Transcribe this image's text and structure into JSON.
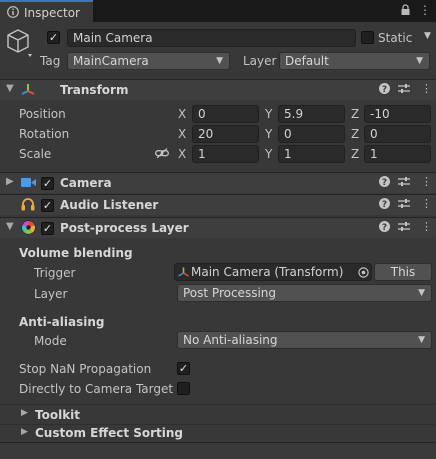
{
  "tab": {
    "title": "Inspector",
    "lock_icon": "lock-icon",
    "menu_icon": "kebab-menu-icon"
  },
  "header": {
    "object_icon": "cube-icon",
    "active": true,
    "name": "Main Camera",
    "static_label": "Static",
    "static_checked": false,
    "tag_label": "Tag",
    "tag_value": "MainCamera",
    "layer_label": "Layer",
    "layer_value": "Default"
  },
  "transform": {
    "title": "Transform",
    "position": {
      "label": "Position",
      "x": "0",
      "y": "5.9",
      "z": "-10"
    },
    "rotation": {
      "label": "Rotation",
      "x": "20",
      "y": "0",
      "z": "0"
    },
    "scale": {
      "label": "Scale",
      "x": "1",
      "y": "1",
      "z": "1"
    },
    "axis_labels": {
      "x": "X",
      "y": "Y",
      "z": "Z"
    }
  },
  "camera": {
    "title": "Camera",
    "enabled": true
  },
  "audio_listener": {
    "title": "Audio Listener",
    "enabled": true
  },
  "postprocess_layer": {
    "title": "Post-process Layer",
    "enabled": true,
    "volume_blending": {
      "section_title": "Volume blending",
      "trigger_label": "Trigger",
      "trigger_value": "Main Camera (Transform)",
      "this_button": "This",
      "layer_label": "Layer",
      "layer_value": "Post Processing"
    },
    "anti_aliasing": {
      "section_title": "Anti-aliasing",
      "mode_label": "Mode",
      "mode_value": "No Anti-aliasing"
    },
    "stop_nan": {
      "label": "Stop NaN Propagation",
      "checked": true
    },
    "direct_to_target": {
      "label": "Directly to Camera Target",
      "checked": false
    },
    "toolkit_label": "Toolkit",
    "custom_sorting_label": "Custom Effect Sorting"
  },
  "colors": {
    "accent": "#3a79bb",
    "panel": "#383838",
    "header": "#3e3e3e"
  }
}
